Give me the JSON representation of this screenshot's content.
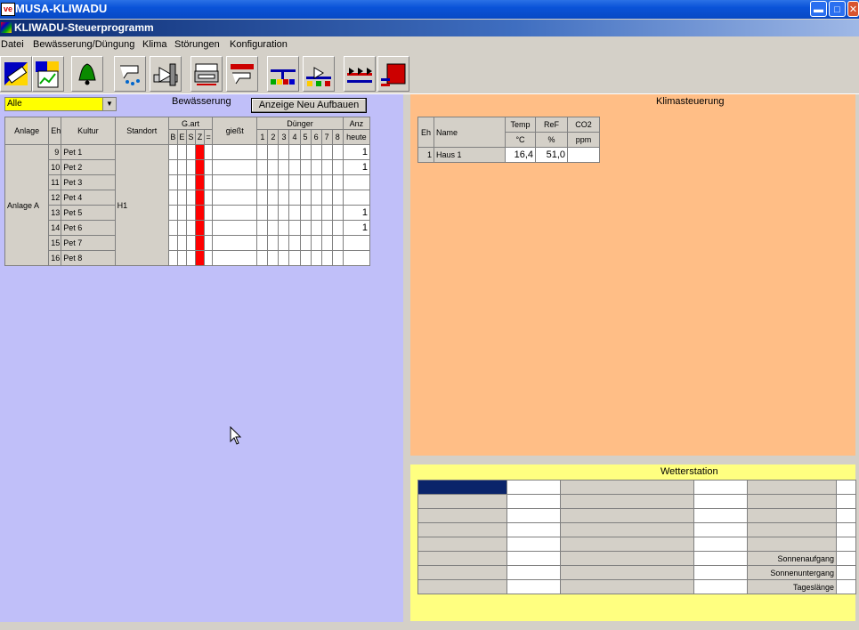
{
  "app": {
    "window_title": "MUSA-KLIWADU",
    "icon_text": "ve",
    "child_title": "KLIWADU-Steuerprogramm"
  },
  "menu": [
    "Datei",
    "Bewässerung/Düngung",
    "Klima",
    "Störungen",
    "Konfiguration"
  ],
  "toolbar": {
    "buttons": [
      "edit-tool",
      "report-chart-tool",
      "alarm-bell",
      "irrigation-hand",
      "valve-pump",
      "printer-tool",
      "irrigation-stop",
      "pipe-system",
      "mixer-valve",
      "sprinkler-valves",
      "tank-heater"
    ]
  },
  "irrigation": {
    "filter_value": "Alle",
    "title": "Bewässerung",
    "rebuild_button": "Anzeige Neu Aufbauen",
    "headers": {
      "anlage": "Anlage",
      "eh": "Eh",
      "kultur": "Kultur",
      "standort": "Standort",
      "gart": "G.art",
      "gart_sub": [
        "B",
        "E",
        "S",
        "Z",
        "="
      ],
      "giesst": "gießt",
      "duenger": "Dünger",
      "duenger_sub": [
        "1",
        "2",
        "3",
        "4",
        "5",
        "6",
        "7",
        "8"
      ],
      "anz": "Anz",
      "heute": "heute"
    },
    "anlage_value": "Anlage A",
    "standort_value": "H1",
    "rows": [
      {
        "eh": "9",
        "kultur": "Pet 1",
        "anz": "1"
      },
      {
        "eh": "10",
        "kultur": "Pet 2",
        "anz": "1"
      },
      {
        "eh": "11",
        "kultur": "Pet 3",
        "anz": ""
      },
      {
        "eh": "12",
        "kultur": "Pet 4",
        "anz": ""
      },
      {
        "eh": "13",
        "kultur": "Pet 5",
        "anz": "1"
      },
      {
        "eh": "14",
        "kultur": "Pet 6",
        "anz": "1"
      },
      {
        "eh": "15",
        "kultur": "Pet 7",
        "anz": ""
      },
      {
        "eh": "16",
        "kultur": "Pet 8",
        "anz": ""
      }
    ]
  },
  "climate": {
    "title": "Klimasteuerung",
    "headers": {
      "eh": "Eh",
      "name": "Name",
      "temp": "Temp",
      "ref": "ReF",
      "co2": "CO2"
    },
    "units": {
      "temp": "°C",
      "ref": "%",
      "co2": "ppm"
    },
    "rows": [
      {
        "eh": "1",
        "name": "Haus 1",
        "temp": "16,4",
        "ref": "51,0",
        "co2": ""
      }
    ]
  },
  "weather": {
    "title": "Wetterstation",
    "labels": [
      "",
      "",
      "",
      "",
      "",
      "Sonnenaufgang",
      "Sonnenuntergang",
      "Tageslänge"
    ]
  },
  "colors": {
    "irrigation_panel": "#c0bff9",
    "climate_panel": "#ffbe86",
    "weather_panel": "#ffff80",
    "filter_dropdown": "#ffff00",
    "z_column": "#ff0000"
  }
}
